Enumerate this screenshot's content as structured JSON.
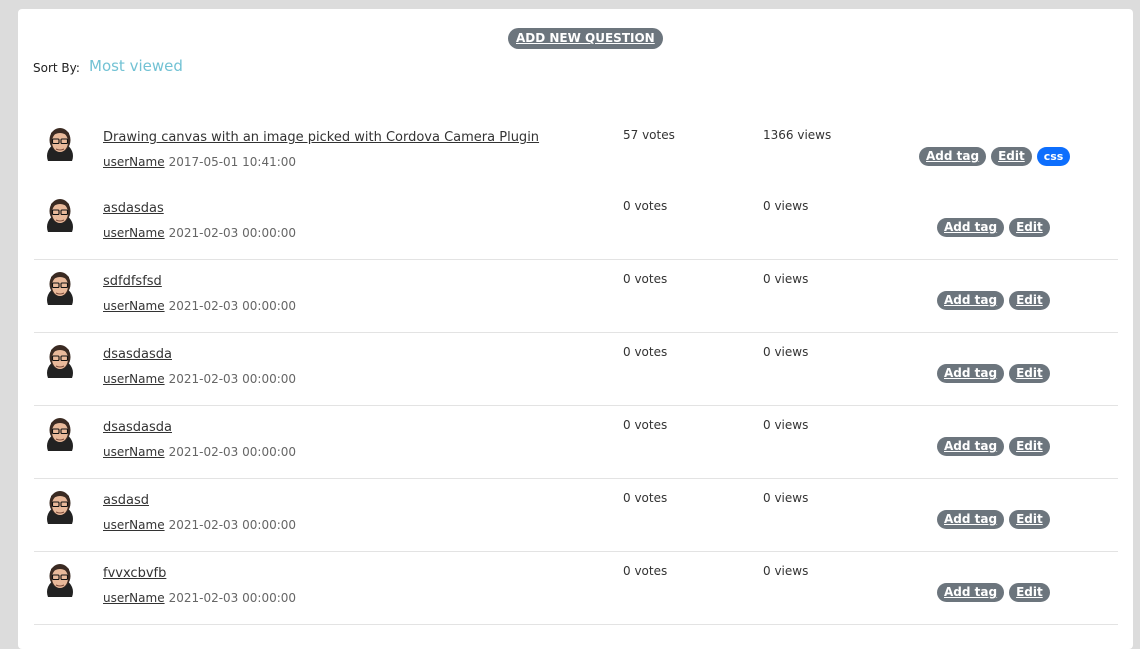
{
  "toolbar": {
    "add_question_label": "ADD NEW QUESTION"
  },
  "sort": {
    "label": "Sort By:",
    "value": "Most viewed"
  },
  "colors": {
    "accent": "#72c2d4",
    "badge": "#6c757d",
    "tag": "#0d6efd"
  },
  "actions": {
    "add_tag": "Add tag",
    "edit": "Edit"
  },
  "questions": [
    {
      "title": "Drawing canvas with an image picked with Cordova Camera Plugin",
      "user": "userName",
      "date": "2017-05-01 10:41:00",
      "votes": "57 votes",
      "views": "1366 views",
      "tags": [
        "css"
      ]
    },
    {
      "title": "asdasdas",
      "user": "userName",
      "date": "2021-02-03 00:00:00",
      "votes": "0 votes",
      "views": "0 views",
      "tags": []
    },
    {
      "title": "sdfdfsfsd",
      "user": "userName",
      "date": "2021-02-03 00:00:00",
      "votes": "0 votes",
      "views": "0 views",
      "tags": []
    },
    {
      "title": "dsasdasda",
      "user": "userName",
      "date": "2021-02-03 00:00:00",
      "votes": "0 votes",
      "views": "0 views",
      "tags": []
    },
    {
      "title": "dsasdasda",
      "user": "userName",
      "date": "2021-02-03 00:00:00",
      "votes": "0 votes",
      "views": "0 views",
      "tags": []
    },
    {
      "title": "asdasd",
      "user": "userName",
      "date": "2021-02-03 00:00:00",
      "votes": "0 votes",
      "views": "0 views",
      "tags": []
    },
    {
      "title": "fvvxcbvfb",
      "user": "userName",
      "date": "2021-02-03 00:00:00",
      "votes": "0 votes",
      "views": "0 views",
      "tags": []
    }
  ]
}
